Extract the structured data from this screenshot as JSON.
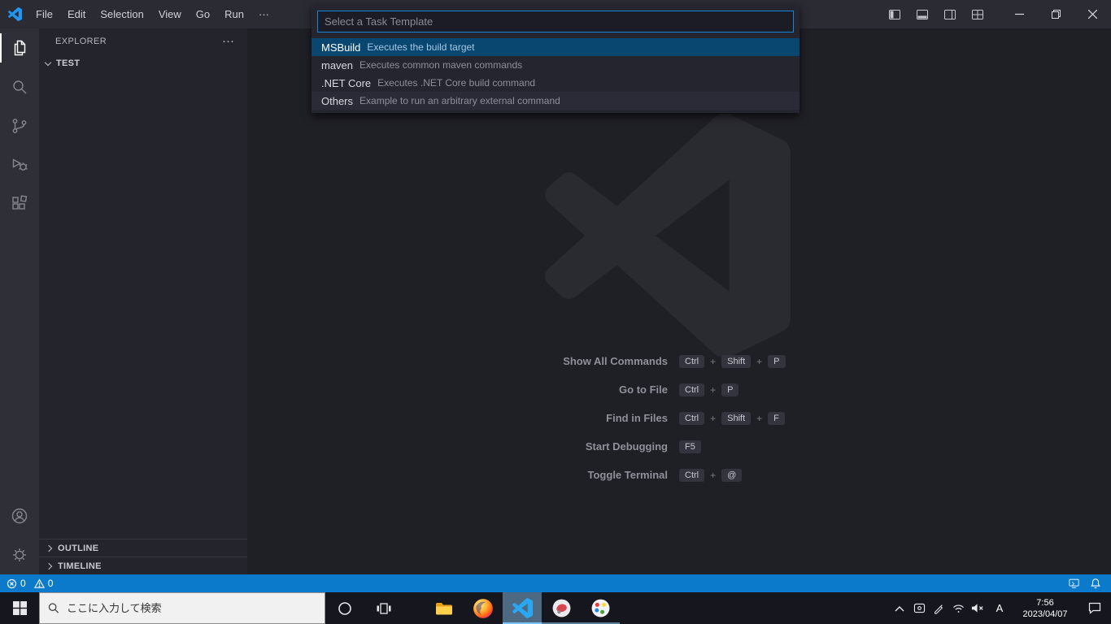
{
  "titlebar": {
    "menus": [
      "File",
      "Edit",
      "Selection",
      "View",
      "Go",
      "Run"
    ],
    "more_label": "···"
  },
  "quickpick": {
    "placeholder": "Select a Task Template",
    "items": [
      {
        "label": "MSBuild",
        "description": "Executes the build target",
        "selected": true,
        "hover": false
      },
      {
        "label": "maven",
        "description": "Executes common maven commands",
        "selected": false,
        "hover": false
      },
      {
        "label": ".NET Core",
        "description": "Executes .NET Core build command",
        "selected": false,
        "hover": false
      },
      {
        "label": "Others",
        "description": "Example to run an arbitrary external command",
        "selected": false,
        "hover": true
      }
    ]
  },
  "sidebar": {
    "title": "EXPLORER",
    "actions_label": "···",
    "folder": "TEST",
    "sections": [
      {
        "label": "OUTLINE"
      },
      {
        "label": "TIMELINE"
      }
    ]
  },
  "editor": {
    "key_separator": "+",
    "shortcuts": [
      {
        "label": "Show All Commands",
        "keys": [
          "Ctrl",
          "Shift",
          "P"
        ]
      },
      {
        "label": "Go to File",
        "keys": [
          "Ctrl",
          "P"
        ]
      },
      {
        "label": "Find in Files",
        "keys": [
          "Ctrl",
          "Shift",
          "F"
        ]
      },
      {
        "label": "Start Debugging",
        "keys": [
          "F5"
        ]
      },
      {
        "label": "Toggle Terminal",
        "keys": [
          "Ctrl",
          "@"
        ]
      }
    ]
  },
  "statusbar": {
    "errors": "0",
    "warnings": "0"
  },
  "taskbar": {
    "search_placeholder": "ここに入力して検索",
    "ime_indicator": "A",
    "clock": {
      "time": "7:56",
      "date": "2023/04/07"
    }
  },
  "colors": {
    "accent_blue": "#0b7acb",
    "focus_border": "#1187da",
    "selection_bg": "#094771",
    "vscode_brand": "#29a9f4"
  }
}
